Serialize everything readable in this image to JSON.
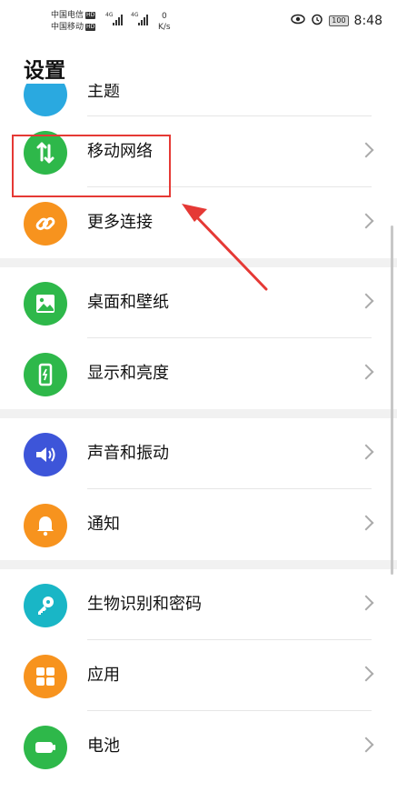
{
  "status_bar": {
    "carrier1": "中国电信",
    "carrier2": "中国移动",
    "hd": "HD",
    "net1": "4G",
    "net2": "4G",
    "speed_value": "0",
    "speed_unit": "K/s",
    "battery": "100",
    "time": "8:48"
  },
  "page": {
    "title": "设置"
  },
  "partial_item": {
    "label": "主题",
    "icon": "brush-icon"
  },
  "groups": [
    [
      {
        "name": "mobile-network",
        "label": "移动网络",
        "color": "#2eb84a",
        "icon": "mobile-data-arrows-icon"
      },
      {
        "name": "more-connections",
        "label": "更多连接",
        "color": "#f7931e",
        "icon": "link-icon"
      }
    ],
    [
      {
        "name": "home-wallpaper",
        "label": "桌面和壁纸",
        "color": "#2eb84a",
        "icon": "picture-icon"
      },
      {
        "name": "display-brightness",
        "label": "显示和亮度",
        "color": "#2eb84a",
        "icon": "phone-display-icon"
      }
    ],
    [
      {
        "name": "sound-vibration",
        "label": "声音和振动",
        "color": "#3d55d9",
        "icon": "speaker-icon"
      },
      {
        "name": "notifications",
        "label": "通知",
        "color": "#f7931e",
        "icon": "bell-icon"
      }
    ],
    [
      {
        "name": "biometrics-password",
        "label": "生物识别和密码",
        "color": "#19b6c6",
        "icon": "key-icon"
      },
      {
        "name": "apps",
        "label": "应用",
        "color": "#f7931e",
        "icon": "apps-grid-icon"
      },
      {
        "name": "battery",
        "label": "电池",
        "color": "#2eb84a",
        "icon": "battery-icon"
      }
    ]
  ]
}
